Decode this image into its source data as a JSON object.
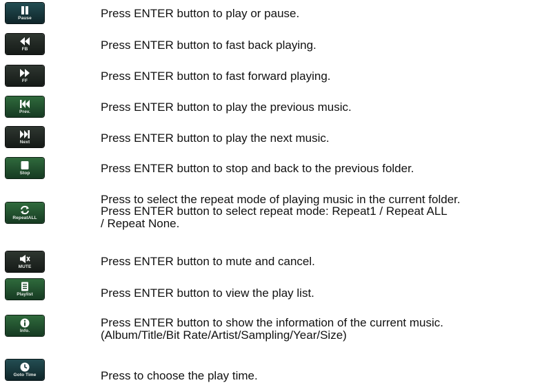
{
  "rows": [
    {
      "button_label": "Pause",
      "icon": "pause-icon",
      "lines": [
        "Press ENTER button to play or pause."
      ]
    },
    {
      "button_label": "FB",
      "icon": "fast-back-icon",
      "lines": [
        "Press ENTER button to fast back playing."
      ]
    },
    {
      "button_label": "FF",
      "icon": "fast-forward-icon",
      "lines": [
        "Press ENTER button to fast forward playing."
      ]
    },
    {
      "button_label": "Prev.",
      "icon": "previous-track-icon",
      "lines": [
        "Press ENTER button to play the previous music."
      ]
    },
    {
      "button_label": "Next",
      "icon": "next-track-icon",
      "lines": [
        "Press ENTER button to play the next music."
      ]
    },
    {
      "button_label": "Stop",
      "icon": "stop-icon",
      "lines": [
        "Press ENTER button to stop and back to the previous folder."
      ]
    },
    {
      "button_label": "RepeatALL",
      "icon": "repeat-icon",
      "lines": [
        "Press to select the repeat mode of playing music in the current folder.",
        "Press ENTER button to select repeat mode: Repeat1 / Repeat ALL",
        "/ Repeat None."
      ]
    },
    {
      "button_label": "MUTE",
      "icon": "mute-icon",
      "lines": [
        "Press ENTER button to mute and cancel."
      ]
    },
    {
      "button_label": "Playlist",
      "icon": "playlist-icon",
      "lines": [
        "Press ENTER button to view the play list."
      ]
    },
    {
      "button_label": "Info.",
      "icon": "info-icon",
      "lines": [
        "Press ENTER button to show the information of the current music.",
        "(Album/Title/Bit Rate/Artist/Sampling/Year/Size)"
      ]
    },
    {
      "button_label": "Goto Time",
      "icon": "clock-icon",
      "lines": [
        "Press to choose the play time."
      ]
    }
  ]
}
